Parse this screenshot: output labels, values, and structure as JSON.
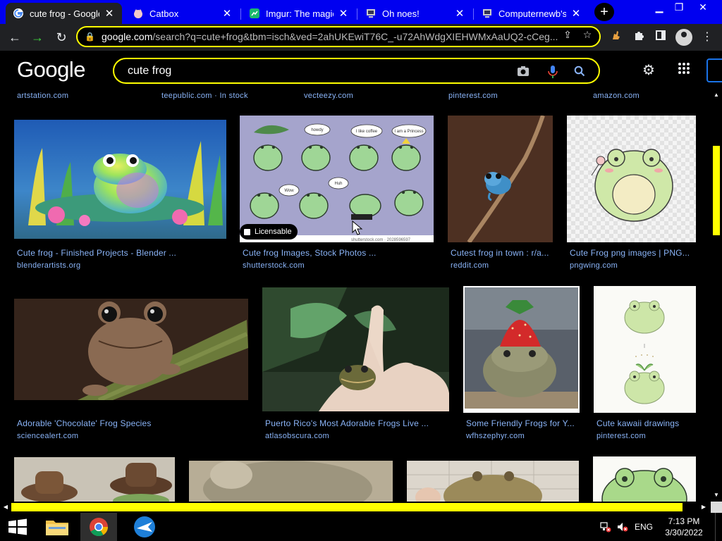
{
  "browser": {
    "tabs": [
      {
        "title": "cute frog - Google",
        "favicon": "google-g-icon",
        "active": true
      },
      {
        "title": "Catbox",
        "favicon": "catbox-icon",
        "active": false
      },
      {
        "title": "Imgur: The magic",
        "favicon": "imgur-icon",
        "active": false
      },
      {
        "title": "Oh noes!",
        "favicon": "computernewb-icon",
        "active": false
      },
      {
        "title": "Computernewb's I",
        "favicon": "computernewb-icon",
        "active": false
      }
    ],
    "url_host": "google.com",
    "url_path": "/search?q=cute+frog&tbm=isch&ved=2ahUKEwiT76C_-u72AhWdgXIEHWMxAaUQ2-cCeg..."
  },
  "google": {
    "logo": "Google",
    "query": "cute frog"
  },
  "top_sources": [
    {
      "text": "artstation.com"
    },
    {
      "text": "teepublic.com · In stock"
    },
    {
      "text": "vecteezy.com"
    },
    {
      "text": "pinterest.com"
    },
    {
      "text": "amazon.com"
    }
  ],
  "results": [
    {
      "title": "Cute frog - Finished Projects - Blender ...",
      "source": "blenderartists.org"
    },
    {
      "title": "Cute frog Images, Stock Photos ...",
      "source": "shutterstock.com",
      "badge": "Licensable",
      "watermark": "shutterstock.com · 2028596597"
    },
    {
      "title": "Cutest frog in town : r/a...",
      "source": "reddit.com"
    },
    {
      "title": "Cute Frog png images | PNG...",
      "source": "pngwing.com"
    },
    {
      "title": "Adorable 'Chocolate' Frog Species",
      "source": "sciencealert.com"
    },
    {
      "title": "Puerto Rico's Most Adorable Frogs Live ...",
      "source": "atlasobscura.com"
    },
    {
      "title": "Some Friendly Frogs for Y...",
      "source": "wfhszephyr.com"
    },
    {
      "title": "Cute kawaii drawings",
      "source": "pinterest.com"
    }
  ],
  "sticker_bubbles": [
    "howdy",
    "I like coffee",
    "I am a Princess",
    "Wow",
    "Huh"
  ],
  "taskbar": {
    "time": "7:13 PM",
    "date": "3/30/2022",
    "lang": "ENG"
  },
  "colors": {
    "tabstrip": "#0000f0",
    "focus_ring": "#ffff00",
    "link": "#8ab4f8",
    "background": "#000000"
  }
}
